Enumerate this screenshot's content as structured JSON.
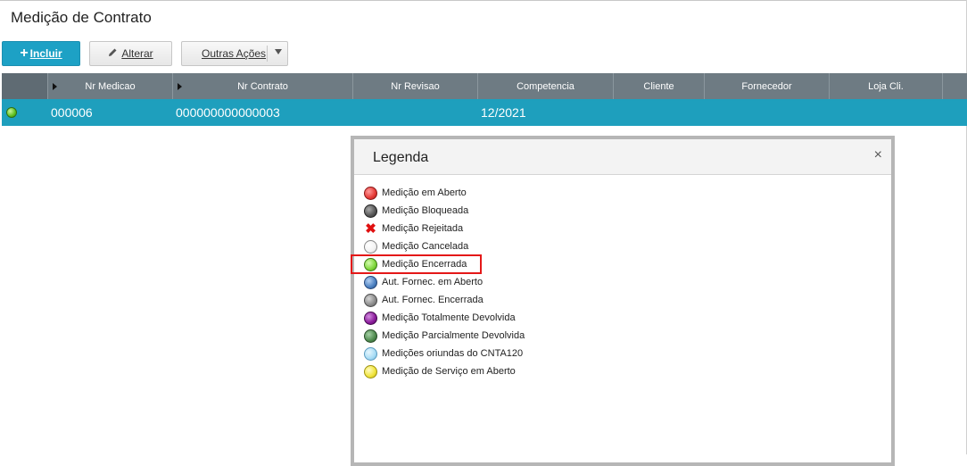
{
  "page": {
    "title": "Medição de Contrato"
  },
  "toolbar": {
    "incluir_label": "Incluir",
    "alterar_label": "Alterar",
    "outras_label": "Outras Ações"
  },
  "grid": {
    "columns": [
      "Nr Medicao",
      "Nr Contrato",
      "Nr Revisao",
      "Competencia",
      "Cliente",
      "Fornecedor",
      "Loja Cli."
    ],
    "rows": [
      {
        "status": "Medição Encerrada",
        "nr_medicao": "000006",
        "nr_contrato": "000000000000003",
        "nr_revisao": "",
        "competencia": "12/2021",
        "cliente": "",
        "fornecedor": "",
        "loja_cli": ""
      }
    ]
  },
  "legend": {
    "title": "Legenda",
    "close_symbol": "×",
    "items": [
      {
        "label": "Medição em Aberto",
        "color": "#e53935"
      },
      {
        "label": "Medição Bloqueada",
        "color": "#555555"
      },
      {
        "label": "Medição Rejeitada",
        "color": "#e01010",
        "icon": "x-icon"
      },
      {
        "label": "Medição Cancelada",
        "color": "#f2f2f2"
      },
      {
        "label": "Medição Encerrada",
        "color": "#7ed63a",
        "highlighted": true
      },
      {
        "label": "Aut. Fornec. em Aberto",
        "color": "#4a7fc0"
      },
      {
        "label": "Aut. Fornec. Encerrada",
        "color": "#8a8a8a"
      },
      {
        "label": "Medição Totalmente Devolvida",
        "color": "#8a1a9a"
      },
      {
        "label": "Medição Parcialmente Devolvida",
        "color": "#4e8a4e"
      },
      {
        "label": "Medições oriundas do CNTA120",
        "color": "#a8dcf5"
      },
      {
        "label": "Medição de Serviço em Aberto",
        "color": "#f0e43a"
      }
    ]
  }
}
